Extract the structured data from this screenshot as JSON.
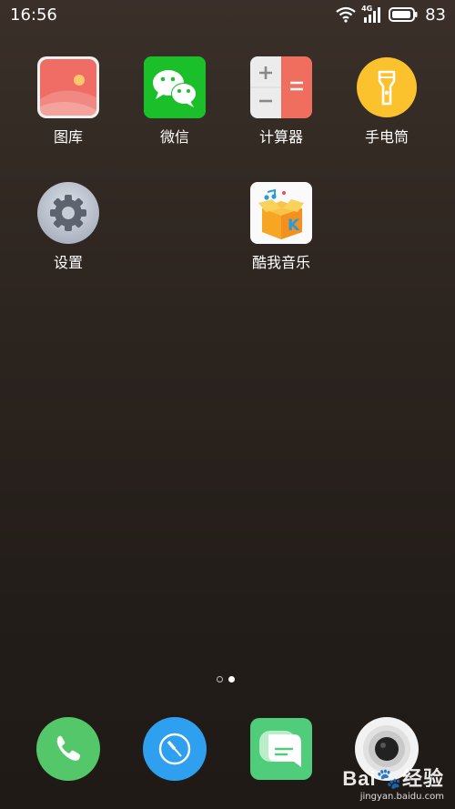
{
  "status_bar": {
    "time": "16:56",
    "network_label": "4G",
    "battery_percent": "83"
  },
  "apps": [
    {
      "label": "图库",
      "icon": "gallery-icon"
    },
    {
      "label": "微信",
      "icon": "wechat-icon"
    },
    {
      "label": "计算器",
      "icon": "calculator-icon"
    },
    {
      "label": "手电筒",
      "icon": "flashlight-icon"
    },
    {
      "label": "设置",
      "icon": "settings-gear-icon"
    },
    {
      "label": "酷我音乐",
      "icon": "kuwo-music-icon"
    }
  ],
  "page_indicator": {
    "total": 2,
    "current": 2
  },
  "dock": [
    {
      "icon": "phone-icon"
    },
    {
      "icon": "browser-compass-icon"
    },
    {
      "icon": "messages-icon"
    },
    {
      "icon": "camera-icon"
    }
  ],
  "watermark": {
    "logo_text": "Bai🐾经验",
    "url": "jingyan.baidu.com"
  }
}
